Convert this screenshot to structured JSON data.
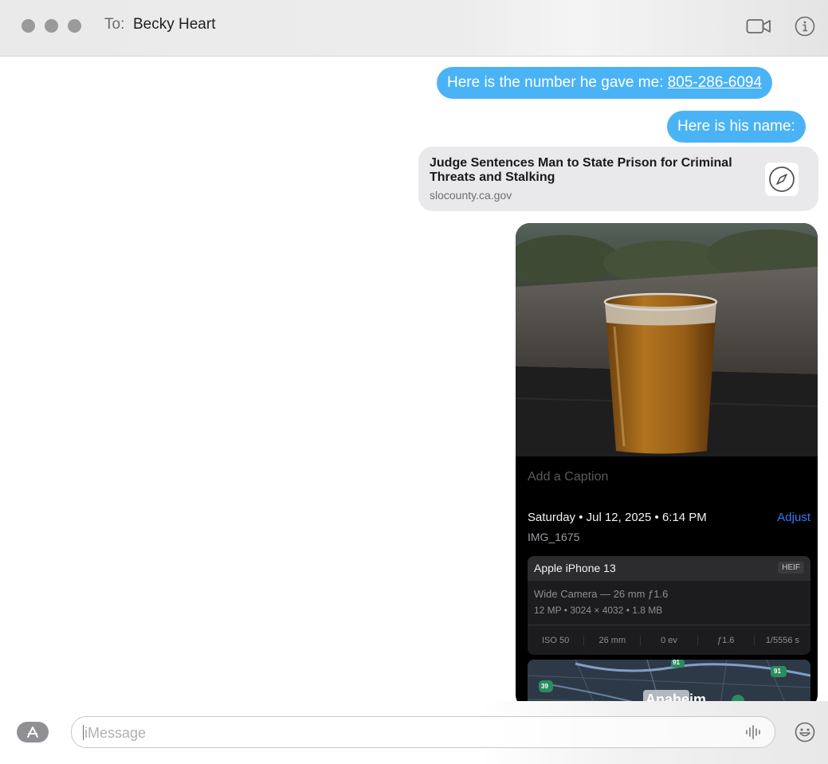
{
  "header": {
    "to_label": "To:",
    "recipient": "Becky Heart",
    "traffic_lights": [
      "close",
      "minimize",
      "zoom"
    ],
    "icons": [
      "video-camera-icon",
      "info-icon"
    ]
  },
  "messages": [
    {
      "prefix": "Here is the number he gave me: ",
      "link": "805-286-6094"
    },
    {
      "text": "Here is his name:"
    }
  ],
  "link_preview": {
    "title": "Judge Sentences Man to State Prison for Criminal Threats and Stalking",
    "domain": "slocounty.ca.gov",
    "icon": "compass-icon"
  },
  "attachment": {
    "caption_placeholder": "Add a Caption",
    "date": "Saturday • Jul 12, 2025 • 6:14 PM",
    "adjust_label": "Adjust",
    "filename": "IMG_1675",
    "camera": {
      "model": "Apple iPhone 13",
      "format": "HEIF",
      "lens": "Wide Camera — 26 mm ƒ1.6",
      "specs": "12 MP • 3024 × 4032 • 1.8 MB",
      "exif": [
        "ISO 50",
        "26 mm",
        "0 ev",
        "ƒ1.6",
        "1/5556 s"
      ]
    },
    "map": {
      "shields": [
        "91",
        "39",
        "91"
      ],
      "city_partial": "Anaheim"
    }
  },
  "composer": {
    "placeholder": "iMessage",
    "icons": [
      "app-store-icon",
      "audio-waveform-icon",
      "emoji-icon"
    ]
  },
  "colors": {
    "bubble_blue": "#4ab3f5",
    "link_card": "#e9e9eb",
    "adjust_blue": "#2f7cf6"
  }
}
